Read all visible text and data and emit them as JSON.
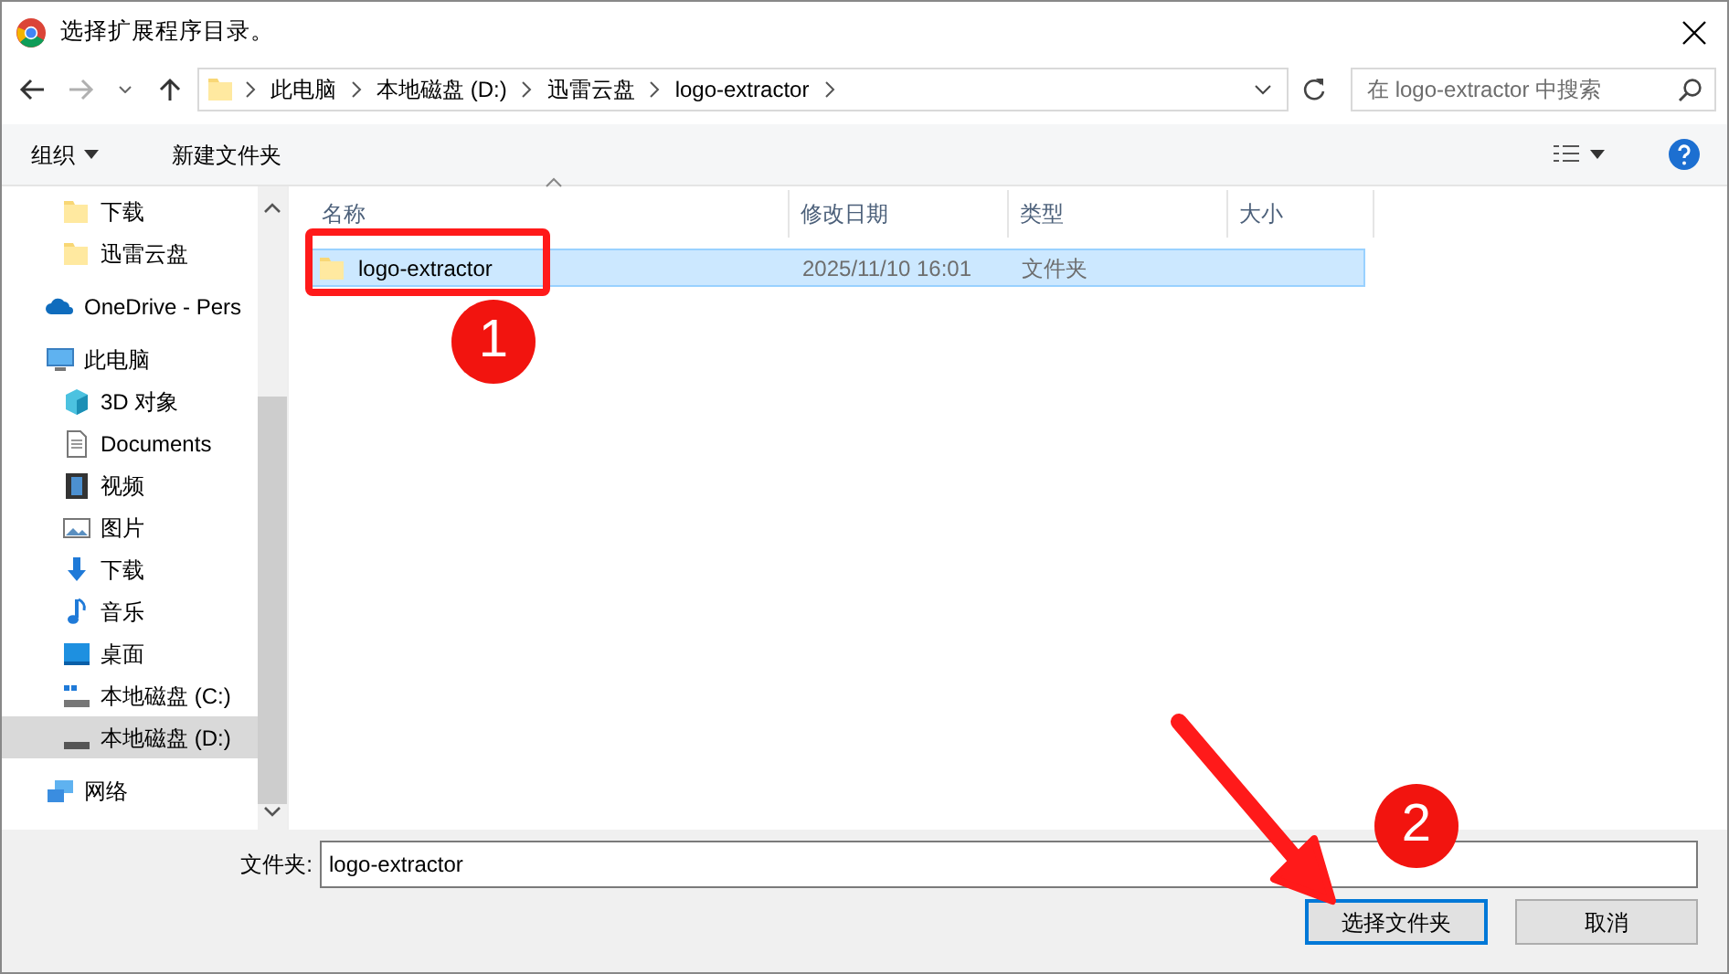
{
  "window": {
    "title": "选择扩展程序目录。"
  },
  "navigation": {
    "back_disabled": false,
    "forward_disabled": true
  },
  "address_bar": {
    "breadcrumbs": [
      "此电脑",
      "本地磁盘 (D:)",
      "迅雷云盘",
      "logo-extractor"
    ]
  },
  "search": {
    "placeholder": "在 logo-extractor 中搜索"
  },
  "toolbar": {
    "organize": "组织",
    "new_folder": "新建文件夹"
  },
  "sidebar": {
    "leading_children": [
      {
        "label": "下载",
        "kind": "folder",
        "selected": false
      },
      {
        "label": "迅雷云盘",
        "kind": "folder",
        "selected": false
      }
    ],
    "items": [
      {
        "label": "OneDrive - Pers",
        "kind": "cloud",
        "selected": false
      },
      {
        "label": "此电脑",
        "kind": "pc",
        "selected": false,
        "children": [
          {
            "label": "3D 对象",
            "kind": "cube",
            "selected": false
          },
          {
            "label": "Documents",
            "kind": "document",
            "selected": false
          },
          {
            "label": "视频",
            "kind": "film",
            "selected": false
          },
          {
            "label": "图片",
            "kind": "image",
            "selected": false
          },
          {
            "label": "下载",
            "kind": "download",
            "selected": false
          },
          {
            "label": "音乐",
            "kind": "music",
            "selected": false
          },
          {
            "label": "桌面",
            "kind": "desktop",
            "selected": false
          },
          {
            "label": "本地磁盘 (C:)",
            "kind": "windrive",
            "selected": false
          },
          {
            "label": "本地磁盘 (D:)",
            "kind": "drive",
            "selected": true
          }
        ]
      },
      {
        "label": "网络",
        "kind": "network",
        "selected": false
      }
    ]
  },
  "file_list": {
    "columns": [
      "名称",
      "修改日期",
      "类型",
      "大小"
    ],
    "rows": [
      {
        "name": "logo-extractor",
        "modified": "2025/11/10 16:01",
        "type": "文件夹",
        "selected": true
      }
    ]
  },
  "folder_field": {
    "label": "文件夹:",
    "value": "logo-extractor"
  },
  "buttons": [
    {
      "label": "选择文件夹",
      "kind": "primary"
    },
    {
      "label": "取消",
      "kind": "secondary"
    }
  ],
  "annotations": [
    {
      "kind": "box"
    },
    {
      "kind": "badge",
      "text": "1"
    },
    {
      "kind": "badge",
      "text": "2"
    },
    {
      "kind": "arrow"
    }
  ]
}
